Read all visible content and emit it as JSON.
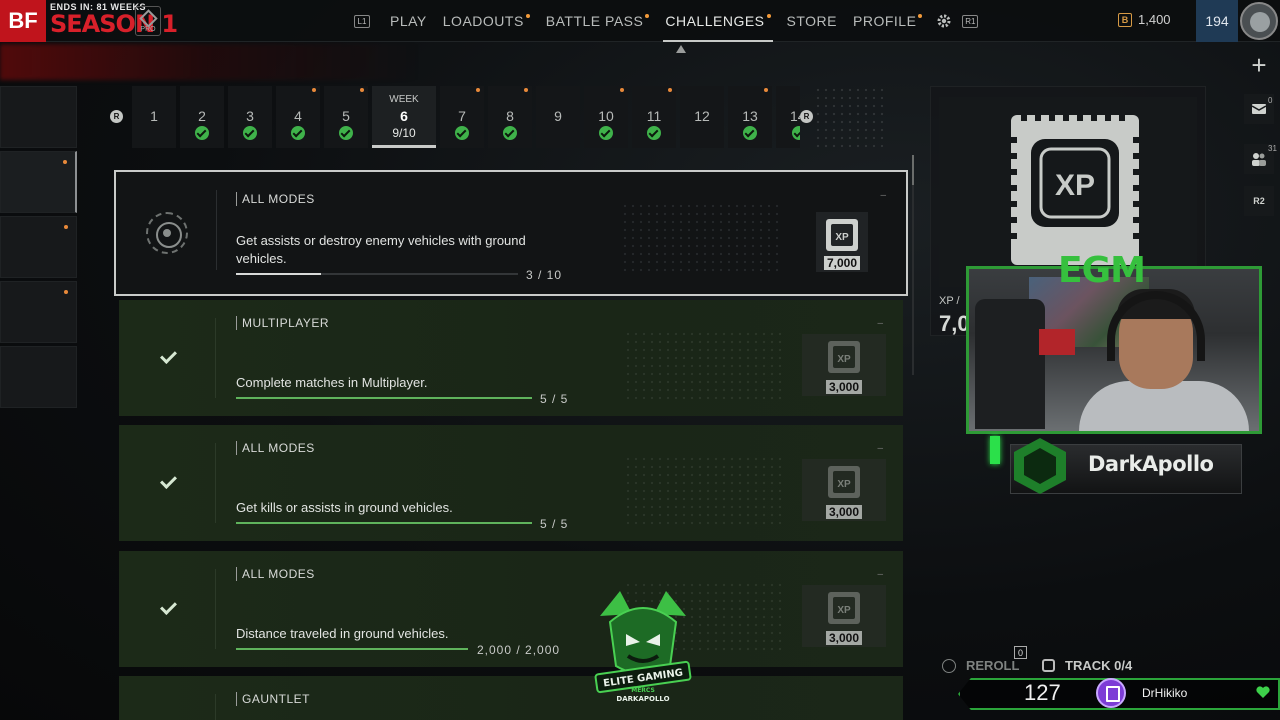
{
  "header": {
    "logo": "BF",
    "season_ends": "ENDS IN: 81 WEEKS",
    "season_name": "SEASON 1",
    "pro_label": "PRO",
    "nav_left_hint": "L1",
    "nav_right_hint": "R1",
    "nav": [
      {
        "label": "PLAY",
        "dot": false
      },
      {
        "label": "LOADOUTS",
        "dot": true
      },
      {
        "label": "BATTLE PASS",
        "dot": true
      },
      {
        "label": "CHALLENGES",
        "dot": true,
        "active": true
      },
      {
        "label": "STORE",
        "dot": false
      },
      {
        "label": "PROFILE",
        "dot": true
      }
    ],
    "currency_icon": "B",
    "currency": "1,400",
    "level": "194"
  },
  "weeks": {
    "left_hint": "R",
    "right_hint": "R",
    "current_label": "WEEK",
    "current_progress": "9/10",
    "tabs": [
      {
        "num": "1",
        "done": false,
        "dot": false
      },
      {
        "num": "2",
        "done": true,
        "dot": false
      },
      {
        "num": "3",
        "done": true,
        "dot": false
      },
      {
        "num": "4",
        "done": true,
        "dot": true
      },
      {
        "num": "5",
        "done": true,
        "dot": true
      },
      {
        "num": "6",
        "current": true
      },
      {
        "num": "7",
        "done": true,
        "dot": true
      },
      {
        "num": "8",
        "done": true,
        "dot": true
      },
      {
        "num": "9",
        "done": false,
        "dot": false
      },
      {
        "num": "10",
        "done": true,
        "dot": true
      },
      {
        "num": "11",
        "done": true,
        "dot": true
      },
      {
        "num": "12",
        "done": false,
        "dot": false
      },
      {
        "num": "13",
        "done": true,
        "dot": true
      },
      {
        "num": "14",
        "done": true,
        "dot": false
      }
    ]
  },
  "challenges": [
    {
      "tag": "ALL MODES",
      "desc": "Get assists or destroy enemy vehicles with ground vehicles.",
      "progress": "3 / 10",
      "fraction": 0.3,
      "xp_label": "XP",
      "xp": "7,000",
      "state": "active"
    },
    {
      "tag": "MULTIPLAYER",
      "desc": "Complete matches in Multiplayer.",
      "progress": "5 / 5",
      "fraction": 1.0,
      "xp_label": "XP",
      "xp": "3,000",
      "state": "done"
    },
    {
      "tag": "ALL MODES",
      "desc": "Get kills or assists in ground vehicles.",
      "progress": "5 / 5",
      "fraction": 1.0,
      "xp_label": "XP",
      "xp": "3,000",
      "state": "done"
    },
    {
      "tag": "ALL MODES",
      "desc": "Distance traveled in ground vehicles.",
      "progress": "2,000 / 2,000",
      "fraction": 1.0,
      "xp_label": "XP",
      "xp": "3,000",
      "state": "done"
    },
    {
      "tag": "GAUNTLET",
      "state": "done"
    }
  ],
  "reward_panel": {
    "chip_label": "XP",
    "label": "XP /",
    "value": "7,0"
  },
  "right_strip": {
    "msg_count": "0",
    "friends_count": "31",
    "hint": "R2"
  },
  "bottom": {
    "reroll": "REROLL",
    "reroll_count": "0",
    "track": "TRACK 0/4"
  },
  "stream": {
    "cam_logo": "EGM",
    "streamer": "DarkApollo",
    "logo_line1": "ELITE GAMING",
    "logo_line2": "MERCS",
    "logo_line3": "DARKAPOLLO",
    "viewers": "127",
    "chat_user": "DrHikiko",
    "colors": {
      "accent": "#2ba53a",
      "twitch": "#7d3cd6"
    }
  }
}
